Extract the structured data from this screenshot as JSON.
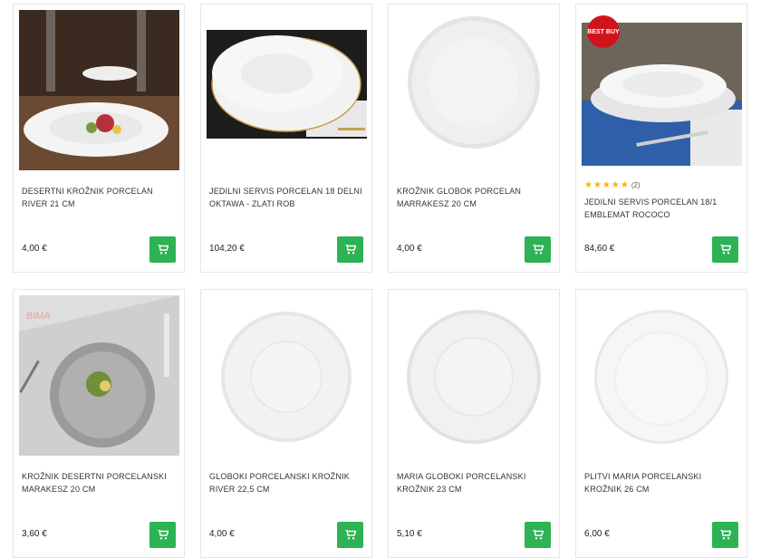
{
  "products": [
    {
      "title": "DESERTNI KROŽNIK PORCELAN RIVER 21 CM",
      "price": "4,00 €"
    },
    {
      "title": "JEDILNI SERVIS PORCELAN 18 DELNI OKTAWA - ZLATI ROB",
      "price": "104,20 €"
    },
    {
      "title": "KROŽNIK GLOBOK PORCELAN MARRAKESZ 20 CM",
      "price": "4,00 €"
    },
    {
      "title": "JEDILNI SERVIS PORCELAN 18/1 EMBLEMAT ROCOCO",
      "price": "84,60 €",
      "badge": "BEST BUY",
      "rating_stars": "★★★★★",
      "rating_count": "(2)"
    },
    {
      "title": "KROŽNIK DESERTNI PORCELANSKI MARAKESZ 20 CM",
      "price": "3,60 €",
      "watermark": "BIMA"
    },
    {
      "title": "GLOBOKI PORCELANSKI KROŽNIK RIVER 22,5 CM",
      "price": "4,00 €"
    },
    {
      "title": "MARIA GLOBOKI PORCELANSKI KROŽNIK 23 CM",
      "price": "5,10 €"
    },
    {
      "title": "PLITVI MARIA PORCELANSKI KROŽNIK 26 CM",
      "price": "6,00 €"
    }
  ],
  "icons": {
    "cart": "shopping-cart-icon"
  },
  "colors": {
    "accent": "#2db354",
    "badge": "#d0141e",
    "star": "#f5b301"
  }
}
